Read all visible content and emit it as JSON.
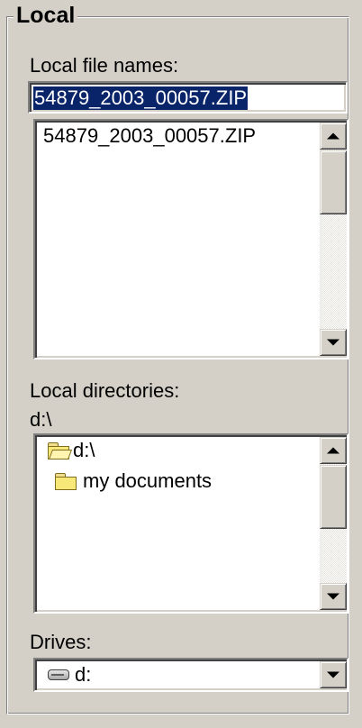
{
  "group": {
    "title": "Local"
  },
  "files": {
    "label": "Local file names:",
    "filename_value": "54879_2003_00057.ZIP",
    "list": [
      "54879_2003_00057.ZIP"
    ]
  },
  "directories": {
    "label": "Local directories:",
    "current_path": "d:\\",
    "items": [
      {
        "name": "d:\\",
        "icon": "open-folder-icon"
      },
      {
        "name": "my documents",
        "icon": "folder-icon"
      }
    ]
  },
  "drives": {
    "label": "Drives:",
    "selected": "d:",
    "icon": "drive-icon"
  }
}
